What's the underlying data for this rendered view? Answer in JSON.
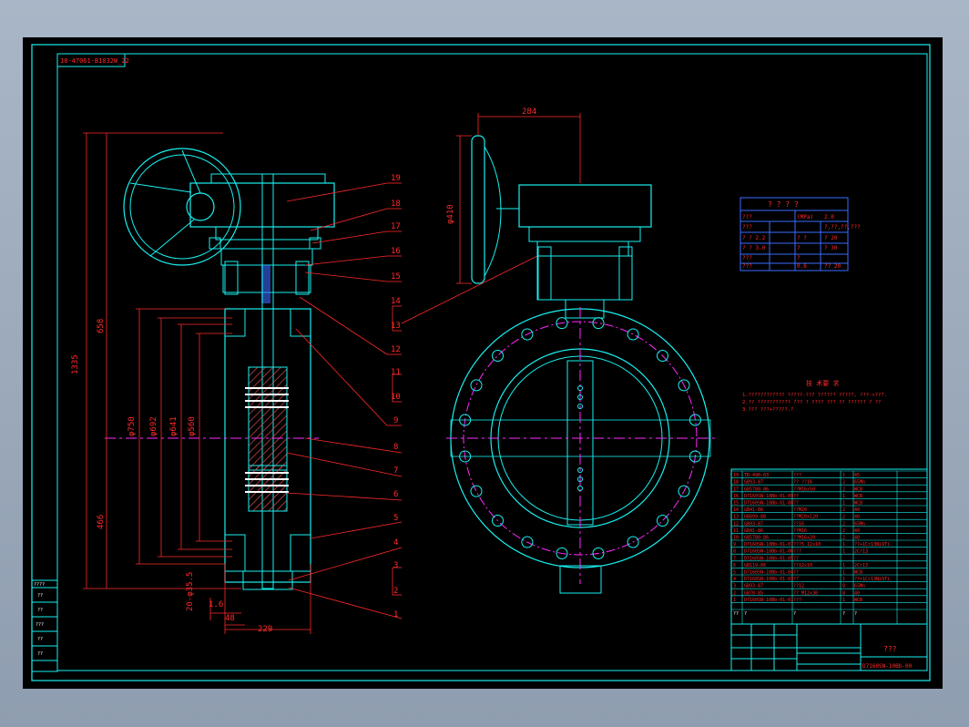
{
  "drawing": {
    "ref_code": "18-47061-B1032W_22",
    "dims": {
      "d1335": "1335",
      "d658": "658",
      "d466": "466",
      "dphi750": "φ750",
      "dphi692": "φ692",
      "dphi641": "φ641",
      "dphi560": "φ560",
      "d20": "20-φ35.5",
      "d1_6": "1.6",
      "d48": "48",
      "d229": "229",
      "d284": "284",
      "dphi410": "φ410"
    },
    "balloons": [
      "19",
      "18",
      "17",
      "16",
      "15",
      "14",
      "13",
      "12",
      "11",
      "10",
      "9",
      "8",
      "7",
      "6",
      "5",
      "4",
      "3",
      "2",
      "1"
    ],
    "spec_table": {
      "title": "? ? ? ?",
      "rows": [
        [
          "???",
          "(MPa)",
          "2.0"
        ],
        [
          "???",
          "",
          "?,??,??,???"
        ],
        [
          "? ? 2.2",
          "? ?",
          "? 20"
        ],
        [
          "? ? 3.0",
          "?",
          "? 30"
        ],
        [
          "???",
          "?",
          ""
        ],
        [
          "???",
          "0.6",
          "?? 20"
        ],
        [
          "??-?",
          "425?",
          ""
        ]
      ]
    },
    "notes": {
      "title": "技 术要 求",
      "lines": [
        "1.???????????? ?????-??? ?????? ?????,    ???->???.",
        "2.?? ??????????? ??? ? ???? ??? ?? ?????? ? ??",
        "3.??? ???+?????.?"
      ]
    },
    "bom": [
      [
        "19",
        "TB-490-03",
        "???",
        "1",
        "45"
      ],
      [
        "18",
        "GB93-87",
        "??  ??16",
        "2",
        "65Mn"
      ],
      [
        "17",
        "GB5780-86",
        "??M16x50",
        "2",
        "WCB"
      ],
      [
        "16",
        "D7160SN-10Bb-01-09",
        "??",
        "1",
        "WCB"
      ],
      [
        "15",
        "D7160SN-10Bb-01-08",
        "??",
        "1",
        "WCB"
      ],
      [
        "14",
        "GB41-86",
        "??M20",
        "2",
        "40"
      ],
      [
        "13",
        "GB899-88",
        "??M20x120",
        "2",
        "40"
      ],
      [
        "12",
        "GB93-87",
        "??16",
        "2",
        "65Mn"
      ],
      [
        "11",
        "GB41-86",
        "??M16",
        "2",
        "40"
      ],
      [
        "10",
        "GB5780-86",
        "??M16x20",
        "2",
        "40"
      ],
      [
        "9",
        "D7160SN-10Bb-01-07",
        "???5 12x10",
        "1",
        "??+1Cr13Ni9Ti"
      ],
      [
        "8",
        "D7160SN-10Bb-01-06",
        "???",
        "1",
        "2Cr13"
      ],
      [
        "7",
        "D7160SN-10Bb-01-05",
        "??",
        "",
        ""
      ],
      [
        "6",
        "GB119-86",
        "??12x10",
        "1",
        "2Cr13"
      ],
      [
        "5",
        "D7160SN-10Bb-01-04",
        "??",
        "1",
        "WCB"
      ],
      [
        "4",
        "D7160SN-10Bb-01-03",
        "??",
        "1",
        "??+1Cr13Ni9Ti"
      ],
      [
        "3",
        "GB93-87",
        "??12",
        "8",
        "65Mn"
      ],
      [
        "2",
        "GB70-85",
        "?? M12x30",
        "8",
        "40"
      ],
      [
        "1",
        "D7160SN-10Bb-01-01",
        "???",
        "1",
        "WCB"
      ]
    ],
    "bom_header": [
      "??",
      "?",
      "?",
      "?",
      "?"
    ],
    "title_block": {
      "name": "???",
      "code": "D7160SN-10Bb-00"
    },
    "revision_labels": [
      "????",
      "??",
      "??",
      "???",
      "??",
      "??"
    ],
    "colors": {
      "outline": "#19f0f0",
      "annotation": "#ff2a2a",
      "centerline": "#ff2aff",
      "section": "#3a6bff",
      "hatch": "#d24a4a",
      "spring": "#ffffff"
    }
  }
}
